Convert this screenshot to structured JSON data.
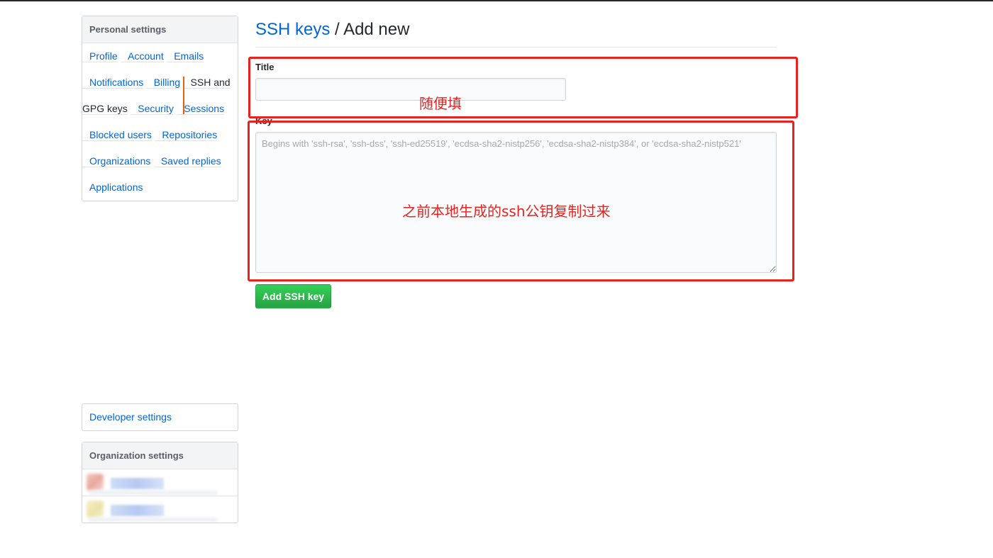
{
  "sidebar": {
    "personal_heading": "Personal settings",
    "items": [
      {
        "label": "Profile"
      },
      {
        "label": "Account"
      },
      {
        "label": "Emails"
      },
      {
        "label": "Notifications"
      },
      {
        "label": "Billing"
      },
      {
        "label": "SSH and GPG keys",
        "selected": true
      },
      {
        "label": "Security"
      },
      {
        "label": "Sessions"
      },
      {
        "label": "Blocked users"
      },
      {
        "label": "Repositories"
      },
      {
        "label": "Organizations"
      },
      {
        "label": "Saved replies"
      },
      {
        "label": "Applications"
      }
    ],
    "developer_label": "Developer settings",
    "org_heading": "Organization settings",
    "accent_color": "#e36209"
  },
  "main": {
    "breadcrumb_link": "SSH keys",
    "breadcrumb_separator": " / ",
    "page_title": "Add new",
    "title_label": "Title",
    "title_value": "",
    "key_label": "Key",
    "key_value": "",
    "key_placeholder": "Begins with 'ssh-rsa', 'ssh-dss', 'ssh-ed25519', 'ecdsa-sha2-nistp256', 'ecdsa-sha2-nistp384', or 'ecdsa-sha2-nistp521'",
    "submit_label": "Add SSH key"
  },
  "annotations": {
    "title_note": "随便填",
    "key_note": "之前本地生成的ssh公钥复制过来",
    "color": "#e8231f"
  }
}
